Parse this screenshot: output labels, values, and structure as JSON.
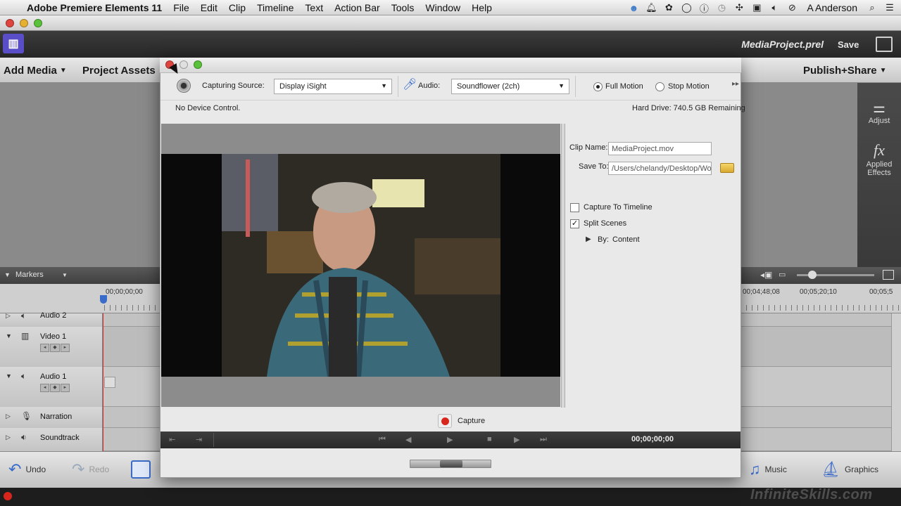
{
  "menubar": {
    "app_name": "Adobe Premiere Elements 11",
    "items": [
      "File",
      "Edit",
      "Clip",
      "Timeline",
      "Text",
      "Action Bar",
      "Tools",
      "Window",
      "Help"
    ],
    "user": "A Anderson"
  },
  "header": {
    "project_name": "MediaProject.prel",
    "save_label": "Save"
  },
  "toolbar": {
    "add_media": "Add Media",
    "project_assets": "Project Assets",
    "publish_share": "Publish+Share"
  },
  "right_panel": {
    "adjust_label": "Adjust",
    "applied_effects_label": "Applied Effects"
  },
  "timeline": {
    "markers_label": "Markers",
    "ruler_start": "00;00;00;00",
    "ruler_t1": "00;04;48;08",
    "ruler_t2": "00;05;20;10",
    "ruler_t3": "00;05;5",
    "tracks": [
      {
        "name": "Audio 2"
      },
      {
        "name": "Video 1"
      },
      {
        "name": "Audio 1"
      },
      {
        "name": "Narration"
      },
      {
        "name": "Soundtrack"
      }
    ]
  },
  "action_bar": {
    "undo": "Undo",
    "redo": "Redo",
    "music": "Music",
    "graphics": "Graphics"
  },
  "dialog": {
    "capturing_source_label": "Capturing Source:",
    "capturing_source_value": "Display iSight",
    "audio_label": "Audio:",
    "audio_value": "Soundflower (2ch)",
    "full_motion_label": "Full Motion",
    "stop_motion_label": "Stop Motion",
    "device_control_text": "No Device Control.",
    "hard_drive_text": "Hard Drive: 740.5 GB Remaining",
    "clip_name_label": "Clip Name:",
    "clip_name_value": "MediaProject.mov",
    "save_to_label": "Save To:",
    "save_to_value": "/Users/chelandy/Desktop/Wo",
    "capture_to_timeline_label": "Capture To Timeline",
    "split_scenes_label": "Split Scenes",
    "by_label": "By:",
    "by_value": "Content",
    "capture_button_label": "Capture",
    "timecode": "00;00;00;00"
  },
  "watermark": "InfiniteSkills.com",
  "colors": {
    "record_red": "#d9261c",
    "premiere_purple": "#5a4ec8",
    "close_red": "#e0443e",
    "minimize_yellow": "#e6b033",
    "zoom_green": "#5ac23a"
  }
}
